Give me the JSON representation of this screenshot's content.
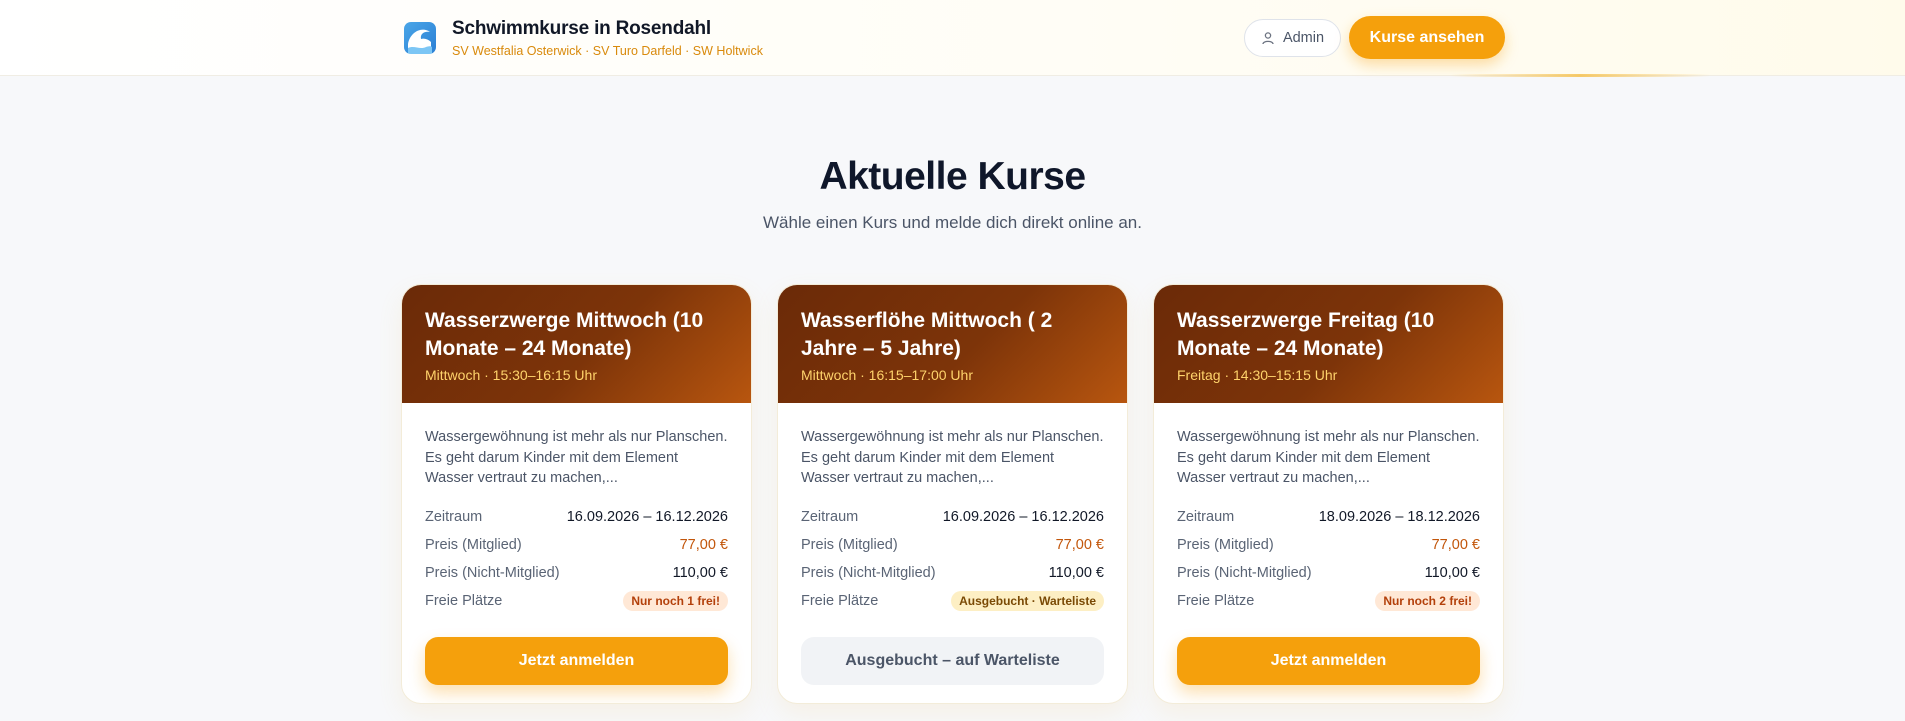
{
  "header": {
    "title": "Schwimmkurse in Rosendahl",
    "subtitle": "SV Westfalia Osterwick · SV Turo Darfeld · SW Holtwick",
    "admin_label": "Admin",
    "courses_label": "Kurse ansehen",
    "logo_icon": "wave-logo-icon",
    "admin_icon": "user-icon"
  },
  "section": {
    "title": "Aktuelle Kurse",
    "subtitle": "Wähle einen Kurs und melde dich direkt online an."
  },
  "labels": {
    "period": "Zeitraum",
    "price_member": "Preis (Mitglied)",
    "price_nonmember": "Preis (Nicht-Mitglied)",
    "free_spots": "Freie Plätze"
  },
  "courses": [
    {
      "title": "Wasserzwerge Mittwoch (10 Monate – 24 Monate)",
      "time": "Mittwoch · 15:30–16:15 Uhr",
      "description": "Wassergewöhnung ist mehr als nur Planschen. Es geht darum Kinder mit dem Element Wasser vertraut zu machen,...",
      "period": "16.09.2026 – 16.12.2026",
      "price_member": "77,00 €",
      "price_nonmember": "110,00 €",
      "spots": "Nur noch 1 frei!",
      "cta": "Jetzt anmelden"
    },
    {
      "title": "Wasserflöhe Mittwoch ( 2 Jahre – 5 Jahre)",
      "time": "Mittwoch · 16:15–17:00 Uhr",
      "description": "Wassergewöhnung ist mehr als nur Planschen. Es geht darum Kinder mit dem Element Wasser vertraut zu machen,...",
      "period": "16.09.2026 – 16.12.2026",
      "price_member": "77,00 €",
      "price_nonmember": "110,00 €",
      "spots": "Ausgebucht · Warteliste",
      "cta": "Ausgebucht – auf Warteliste"
    },
    {
      "title": "Wasserzwerge Freitag (10 Monate – 24 Monate)",
      "time": "Freitag · 14:30–15:15 Uhr",
      "description": "Wassergewöhnung ist mehr als nur Planschen. Es geht darum Kinder mit dem Element Wasser vertraut zu machen,...",
      "period": "18.09.2026 – 18.12.2026",
      "price_member": "77,00 €",
      "price_nonmember": "110,00 €",
      "spots": "Nur noch 2 frei!",
      "cta": "Jetzt anmelden"
    }
  ],
  "colors": {
    "accent": "#f5a00c",
    "header_gradient_dark": "#6b2a08",
    "header_gradient_light": "#b8560f",
    "time_text": "#ffd36b",
    "price": "#c2560b"
  }
}
